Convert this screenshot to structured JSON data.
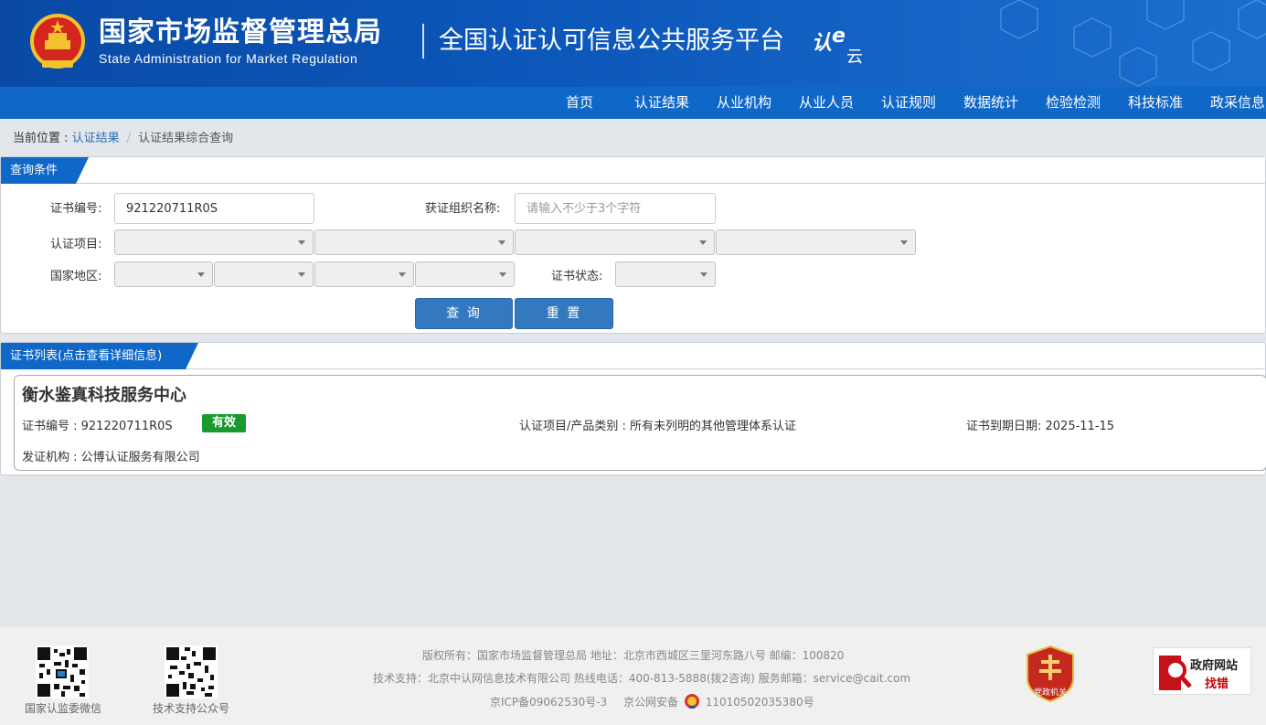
{
  "header": {
    "org_cn": "国家市场监督管理总局",
    "org_en": "State Administration  for  Market Regulation",
    "platform": "全国认证认可信息公共服务平台",
    "logo_text": "认e云"
  },
  "nav": {
    "items": [
      "首页",
      "认证结果",
      "从业机构",
      "从业人员",
      "认证规则",
      "数据统计",
      "检验检测",
      "科技标准",
      "政采信息"
    ]
  },
  "breadcrumb": {
    "prefix": "当前位置 : ",
    "link": "认证结果",
    "separator": "/",
    "current": "认证结果综合查询"
  },
  "query": {
    "tab": "查询条件",
    "cert_no_label": "证书编号:",
    "cert_no_value": "921220711R0S",
    "org_label": "获证组织名称:",
    "org_placeholder": "请输入不少于3个字符",
    "project_label": "认证项目:",
    "region_label": "国家地区:",
    "status_label": "证书状态:",
    "search_btn": "查 询",
    "reset_btn": "重 置"
  },
  "results": {
    "tab": "证书列表(点击查看详细信息)",
    "items": [
      {
        "name": "衡水鉴真科技服务中心",
        "cert_no": "证书编号 : 921220711R0S",
        "status": "有效",
        "category": "认证项目/产品类别 : 所有未列明的其他管理体系认证",
        "expiry": "证书到期日期: 2025-11-15",
        "issuer": "发证机构 : 公博认证服务有限公司"
      }
    ]
  },
  "footer": {
    "qr1_caption": "国家认监委微信",
    "qr2_caption": "技术支持公众号",
    "line1": "版权所有：国家市场监督管理总局    地址：北京市西城区三里河东路八号    邮编：100820",
    "line2": "技术支持：北京中认网信息技术有限公司    热线电话：400-813-5888(拨2咨询)    服务邮箱：service@cait.com",
    "icp": "京ICP备09062530号-3",
    "police": "京公网安备",
    "police_no": "11010502035380号",
    "party_label": "党政机关",
    "gov_line1": "政府网站",
    "gov_line2": "找错"
  },
  "colors": {
    "nav_bg": "#0f67c8",
    "tab_bg": "#0f67c8",
    "button_bg": "#3379c0",
    "valid_badge": "#1a9a2e",
    "link": "#2f6fb5"
  }
}
